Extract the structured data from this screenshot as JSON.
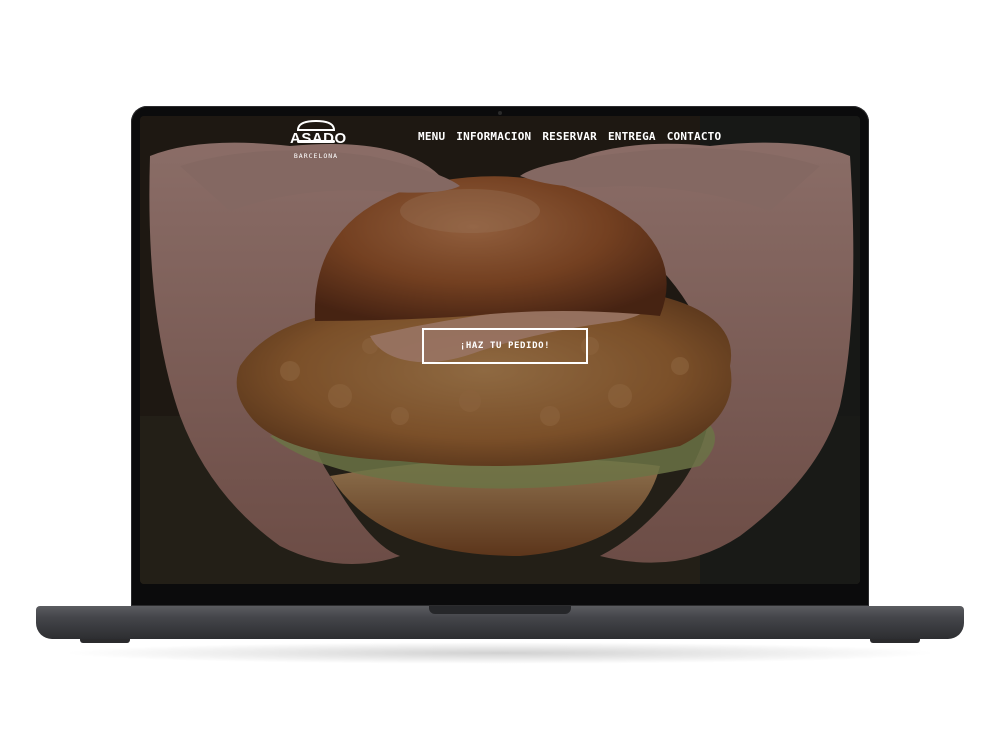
{
  "site": {
    "logo_name": "ASADO",
    "logo_city": "BARCELONA"
  },
  "nav": [
    {
      "label": "MENU"
    },
    {
      "label": "INFORMACION"
    },
    {
      "label": "RESERVAR"
    },
    {
      "label": "ENTREGA"
    },
    {
      "label": "CONTACTO"
    }
  ],
  "hero": {
    "cta_label": "¡HAZ TU PEDIDO!",
    "image_subject": "fried-chicken-burger-held-in-hands"
  },
  "colors": {
    "overlay": "#000000",
    "text": "#ffffff",
    "bun": "#b86a3a",
    "fried_chicken": "#c98a4d",
    "sauce": "#e7a98a",
    "skin": "#c99a8e",
    "laptop_base": "#4a4b4f"
  }
}
